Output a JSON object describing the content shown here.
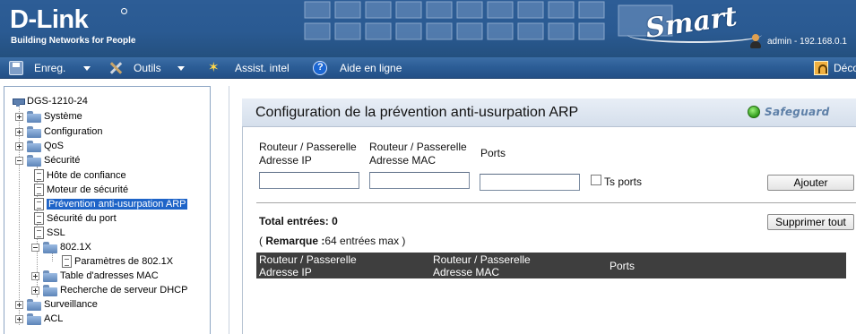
{
  "header": {
    "logo_text": "D-Link",
    "logo_tagline": "Building Networks for People",
    "product_logo": "Smart",
    "user_info": "admin - 192.168.0.1"
  },
  "menu": {
    "save": {
      "label": "Enreg.",
      "icon": "floppy-disk-icon"
    },
    "tools": {
      "label": "Outils",
      "icon": "tools-icon"
    },
    "wizard": {
      "label": "Assist. intel",
      "icon": "wizard-icon"
    },
    "help": {
      "label": "Aide en ligne",
      "icon": "help-icon"
    },
    "logout": {
      "label": "Déco",
      "icon": "logout-icon"
    }
  },
  "tree": {
    "root": "DGS-1210-24",
    "items": [
      {
        "label": "Système",
        "type": "folder",
        "expanded": false
      },
      {
        "label": "Configuration",
        "type": "folder",
        "expanded": false
      },
      {
        "label": "QoS",
        "type": "folder",
        "expanded": false
      },
      {
        "label": "Sécurité",
        "type": "folder",
        "expanded": true
      },
      {
        "label": "Hôte de confiance",
        "type": "page"
      },
      {
        "label": "Moteur de sécurité",
        "type": "page"
      },
      {
        "label": "Prévention anti-usurpation ARP",
        "type": "page",
        "selected": true
      },
      {
        "label": "Sécurité du port",
        "type": "page"
      },
      {
        "label": "SSL",
        "type": "page"
      },
      {
        "label": "802.1X",
        "type": "folder",
        "expanded": true
      },
      {
        "label": "Paramètres de 802.1X",
        "type": "page"
      },
      {
        "label": "Table d'adresses MAC",
        "type": "folder",
        "expanded": false
      },
      {
        "label": "Recherche de serveur DHCP",
        "type": "folder",
        "expanded": false
      },
      {
        "label": "Surveillance",
        "type": "folder",
        "expanded": false
      },
      {
        "label": "ACL",
        "type": "folder",
        "expanded": false
      }
    ]
  },
  "content": {
    "title": "Configuration de la prévention anti-usurpation ARP",
    "safeguard_label": "Safeguard",
    "form": {
      "ip_label_1": "Routeur / Passerelle",
      "ip_label_2": "Adresse IP",
      "mac_label_1": "Routeur / Passerelle",
      "mac_label_2": "Adresse MAC",
      "ports_label": "Ports",
      "ip_value": "",
      "mac_value": "",
      "ports_value": "",
      "all_ports_label": "Ts ports",
      "all_ports_checked": false,
      "add_button": "Ajouter"
    },
    "total_entries": "Total entrées: 0",
    "delete_all_button": "Supprimer tout",
    "remark_bold": "Remarque :",
    "remark_text": "64 entrées max )",
    "remark_open": "( ",
    "table": {
      "headers": [
        [
          "Routeur / Passerelle",
          "Adresse IP"
        ],
        [
          "Routeur / Passerelle",
          "Adresse MAC"
        ],
        [
          "Ports"
        ]
      ],
      "rows": []
    }
  },
  "colors": {
    "header_blue": "#2a5a92",
    "menu_blue": "#2b5c95",
    "selection_blue": "#1e64c8",
    "table_header": "#3e3e3e",
    "safeguard_green": "#2f9a1a"
  }
}
